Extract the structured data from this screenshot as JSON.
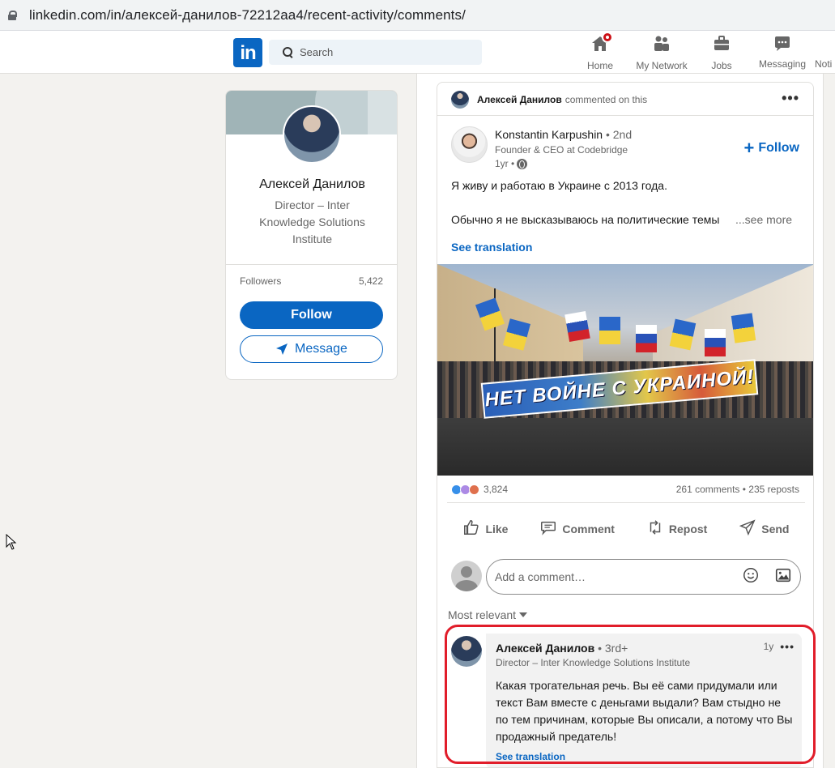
{
  "browser": {
    "url": "linkedin.com/in/алексей-данилов-72212aa4/recent-activity/comments/"
  },
  "nav": {
    "logo": "in",
    "search_placeholder": "Search",
    "items": [
      {
        "label": "Home",
        "icon": "home-icon"
      },
      {
        "label": "My Network",
        "icon": "network-icon"
      },
      {
        "label": "Jobs",
        "icon": "briefcase-icon"
      },
      {
        "label": "Messaging",
        "icon": "messaging-icon"
      },
      {
        "label": "Noti",
        "icon": "bell-icon"
      }
    ]
  },
  "profile": {
    "name": "Алексей Данилов",
    "headline": "Director – Inter Knowledge Solutions Institute",
    "followers_label": "Followers",
    "followers_count": "5,422",
    "follow_button": "Follow",
    "message_button": "Message"
  },
  "activity": {
    "actor": "Алексей Данилов",
    "action": "commented on this"
  },
  "post": {
    "author": "Konstantin Karpushin",
    "degree": " • 2nd",
    "author_headline": "Founder & CEO at Codebridge",
    "time": "1yr •",
    "follow_label": "Follow",
    "text_line1": "Я живу и работаю в Украине с 2013 года.",
    "text_line2": "Обычно я не высказываюсь на политические темы",
    "see_more": "...see more",
    "see_translation": "See translation",
    "image_banner_text": "НЕТ ВОЙНЕ С УКРАИНОЙ!",
    "reactions_count": "3,824",
    "comments_reposts": "261 comments • 235 reposts",
    "actions": [
      {
        "label": "Like",
        "icon": "thumbs-up-icon",
        "glyph": "👍"
      },
      {
        "label": "Comment",
        "icon": "comment-icon",
        "glyph": "💬"
      },
      {
        "label": "Repost",
        "icon": "repost-icon",
        "glyph": "⇄"
      },
      {
        "label": "Send",
        "icon": "send-icon",
        "glyph": "➤"
      }
    ],
    "comment_placeholder": "Add a comment…",
    "sort_label": "Most relevant"
  },
  "comment": {
    "author": "Алексей Данилов",
    "degree": " • 3rd+",
    "headline": "Director – Inter Knowledge Solutions Institute",
    "time": "1y",
    "text": "Какая трогательная речь. Вы её сами придумали или текст Вам вместе с деньгами выдали? Вам стыдно не по тем причинам, которые Вы описали, а потому что Вы продажный предатель!",
    "see_translation": "See translation"
  },
  "colors": {
    "brand": "#0a66c2",
    "highlight": "#e11d2a",
    "background": "#f3f2ef"
  }
}
